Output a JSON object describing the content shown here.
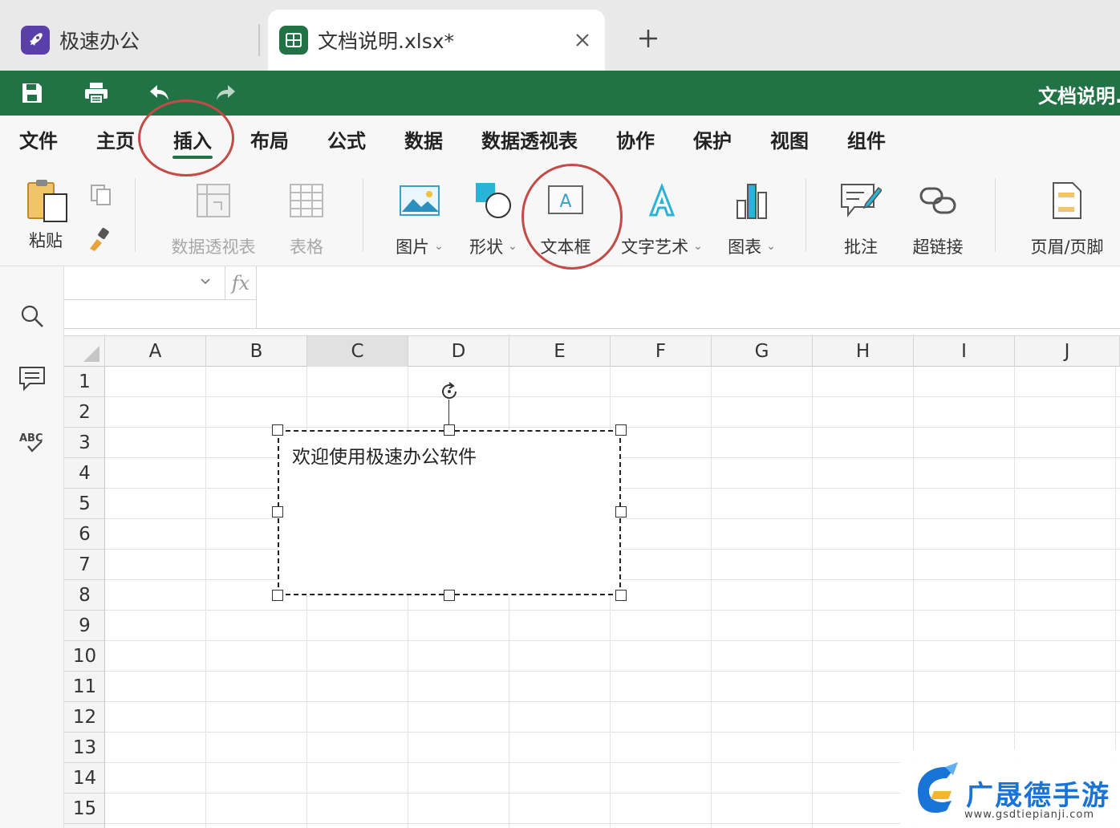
{
  "tabs": {
    "app_label": "极速办公",
    "doc_label": "文档说明.xlsx*"
  },
  "title_bar": {
    "doc_title": "文档说明."
  },
  "menu": {
    "items": [
      "文件",
      "主页",
      "插入",
      "布局",
      "公式",
      "数据",
      "数据透视表",
      "协作",
      "保护",
      "视图",
      "组件"
    ],
    "active": "插入"
  },
  "ribbon": {
    "paste": "粘贴",
    "pivot_table": "数据透视表",
    "table": "表格",
    "picture": "图片",
    "shape": "形状",
    "textbox": "文本框",
    "word_art": "文字艺术",
    "chart": "图表",
    "comment": "批注",
    "hyperlink": "超链接",
    "header_footer": "页眉/页脚"
  },
  "formula_bar": {
    "fx": "fx",
    "name_box_value": ""
  },
  "sheet": {
    "columns": [
      "A",
      "B",
      "C",
      "D",
      "E",
      "F",
      "G",
      "H",
      "I",
      "J"
    ],
    "selected_column": "C",
    "rows": [
      "1",
      "2",
      "3",
      "4",
      "5",
      "6",
      "7",
      "8",
      "9",
      "10",
      "11",
      "12",
      "13",
      "14",
      "15"
    ]
  },
  "textbox": {
    "content": "欢迎使用极速办公软件"
  },
  "watermark": {
    "title": "广晟德手游",
    "url": "www.gsdtiepianji.com"
  },
  "colors": {
    "brand_green": "#217346",
    "annotation_red": "#c44a46",
    "app_icon_purple": "#5b3fa8"
  }
}
